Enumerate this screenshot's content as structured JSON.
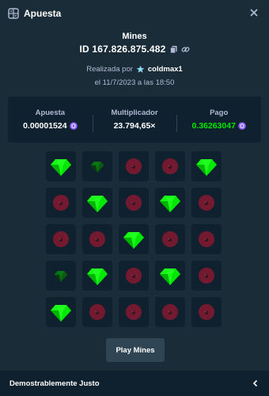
{
  "header": {
    "title": "Apuesta",
    "icon": "receipt-icon",
    "close_icon": "close-icon"
  },
  "bet": {
    "game": "Mines",
    "id": "ID 167.826.875.482",
    "placed_by_label": "Realizada por",
    "user": "coldmax1",
    "date": "el 11/7/2023 a las 18:50"
  },
  "stats": {
    "bet_label": "Apuesta",
    "bet_value": "0.00001524",
    "multiplier_label": "Multiplicador",
    "multiplier_value": "23.794,65×",
    "payout_label": "Pago",
    "payout_value": "0.36263047",
    "currency_icon": "crypto-coin-icon",
    "payout_color": "#00e701"
  },
  "grid": {
    "rows": [
      [
        "gem",
        "gem-dim",
        "mine-dim",
        "mine-dim",
        "gem"
      ],
      [
        "mine-dim",
        "gem",
        "mine-dim",
        "gem",
        "mine-dim"
      ],
      [
        "mine-dim",
        "mine-dim",
        "gem",
        "mine-dim",
        "mine-dim"
      ],
      [
        "gem-dim",
        "gem",
        "mine-dim",
        "gem",
        "mine-dim"
      ],
      [
        "gem",
        "mine-dim",
        "mine-dim",
        "mine-dim",
        "mine-dim"
      ]
    ]
  },
  "actions": {
    "play_label": "Play Mines"
  },
  "footer": {
    "label": "Demostrablemente Justo",
    "icon": "chevron-left-icon"
  },
  "colors": {
    "background": "#1a2c38",
    "panel": "#0f212e",
    "gem": "#00e701",
    "mine": "#c2173a"
  }
}
